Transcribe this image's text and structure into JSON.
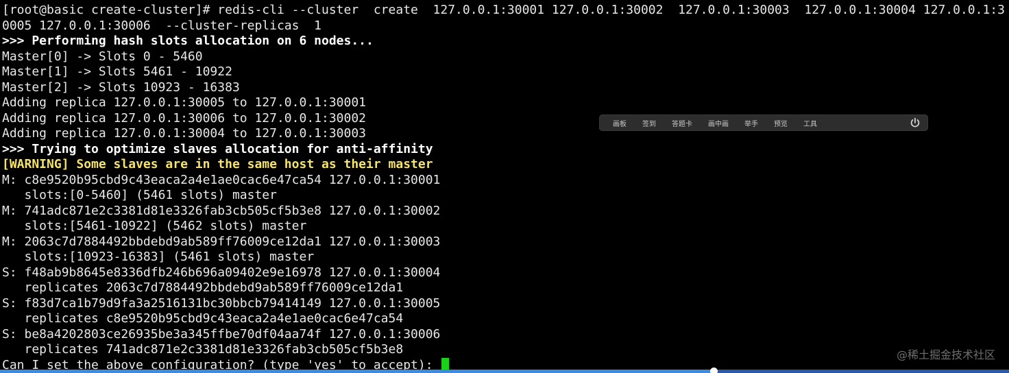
{
  "terminal": {
    "lines": [
      {
        "text": "[root@basic create-cluster]# redis-cli --cluster  create  127.0.0.1:30001 127.0.0.1:30002  127.0.0.1:30003  127.0.0.1:30004 127.0.0.1:3",
        "style": "normal"
      },
      {
        "text": "0005 127.0.0.1:30006  --cluster-replicas  1",
        "style": "normal"
      },
      {
        "text": ">>> Performing hash slots allocation on 6 nodes...",
        "style": "bold"
      },
      {
        "text": "Master[0] -> Slots 0 - 5460",
        "style": "normal"
      },
      {
        "text": "Master[1] -> Slots 5461 - 10922",
        "style": "normal"
      },
      {
        "text": "Master[2] -> Slots 10923 - 16383",
        "style": "normal"
      },
      {
        "text": "Adding replica 127.0.0.1:30005 to 127.0.0.1:30001",
        "style": "normal"
      },
      {
        "text": "Adding replica 127.0.0.1:30006 to 127.0.0.1:30002",
        "style": "normal"
      },
      {
        "text": "Adding replica 127.0.0.1:30004 to 127.0.0.1:30003",
        "style": "normal"
      },
      {
        "text": ">>> Trying to optimize slaves allocation for anti-affinity",
        "style": "bold"
      },
      {
        "text": "[WARNING] Some slaves are in the same host as their master",
        "style": "warn"
      },
      {
        "text": "M: c8e9520b95cbd9c43eaca2a4e1ae0cac6e47ca54 127.0.0.1:30001",
        "style": "normal"
      },
      {
        "text": "   slots:[0-5460] (5461 slots) master",
        "style": "normal"
      },
      {
        "text": "M: 741adc871e2c3381d81e3326fab3cb505cf5b3e8 127.0.0.1:30002",
        "style": "normal"
      },
      {
        "text": "   slots:[5461-10922] (5462 slots) master",
        "style": "normal"
      },
      {
        "text": "M: 2063c7d7884492bbdebd9ab589ff76009ce12da1 127.0.0.1:30003",
        "style": "normal"
      },
      {
        "text": "   slots:[10923-16383] (5461 slots) master",
        "style": "normal"
      },
      {
        "text": "S: f48ab9b8645e8336dfb246b696a09402e9e16978 127.0.0.1:30004",
        "style": "normal"
      },
      {
        "text": "   replicates 2063c7d7884492bbdebd9ab589ff76009ce12da1",
        "style": "normal"
      },
      {
        "text": "S: f83d7ca1b79d9fa3a2516131bc30bbcb79414149 127.0.0.1:30005",
        "style": "normal"
      },
      {
        "text": "   replicates c8e9520b95cbd9c43eaca2a4e1ae0cac6e47ca54",
        "style": "normal"
      },
      {
        "text": "S: be8a4202803ce26935be3a345ffbe70df04aa74f 127.0.0.1:30006",
        "style": "normal"
      },
      {
        "text": "   replicates 741adc871e2c3381d81e3326fab3cb505cf5b3e8",
        "style": "normal"
      }
    ],
    "prompt": "Can I set the above configuration? (type 'yes' to accept): "
  },
  "toolbar": {
    "items": [
      "画板",
      "签到",
      "答题卡",
      "画中画",
      "举手",
      "预览",
      "工具"
    ],
    "power_icon": "power-icon"
  },
  "watermark": "@稀土掘金技术社区",
  "playback": {
    "progress_fraction": 0.707
  },
  "colors": {
    "background": "#000000",
    "text": "#e8e8e8",
    "warning": "#f5e36a",
    "cursor": "#19d219",
    "progress": "#3d8be0"
  }
}
